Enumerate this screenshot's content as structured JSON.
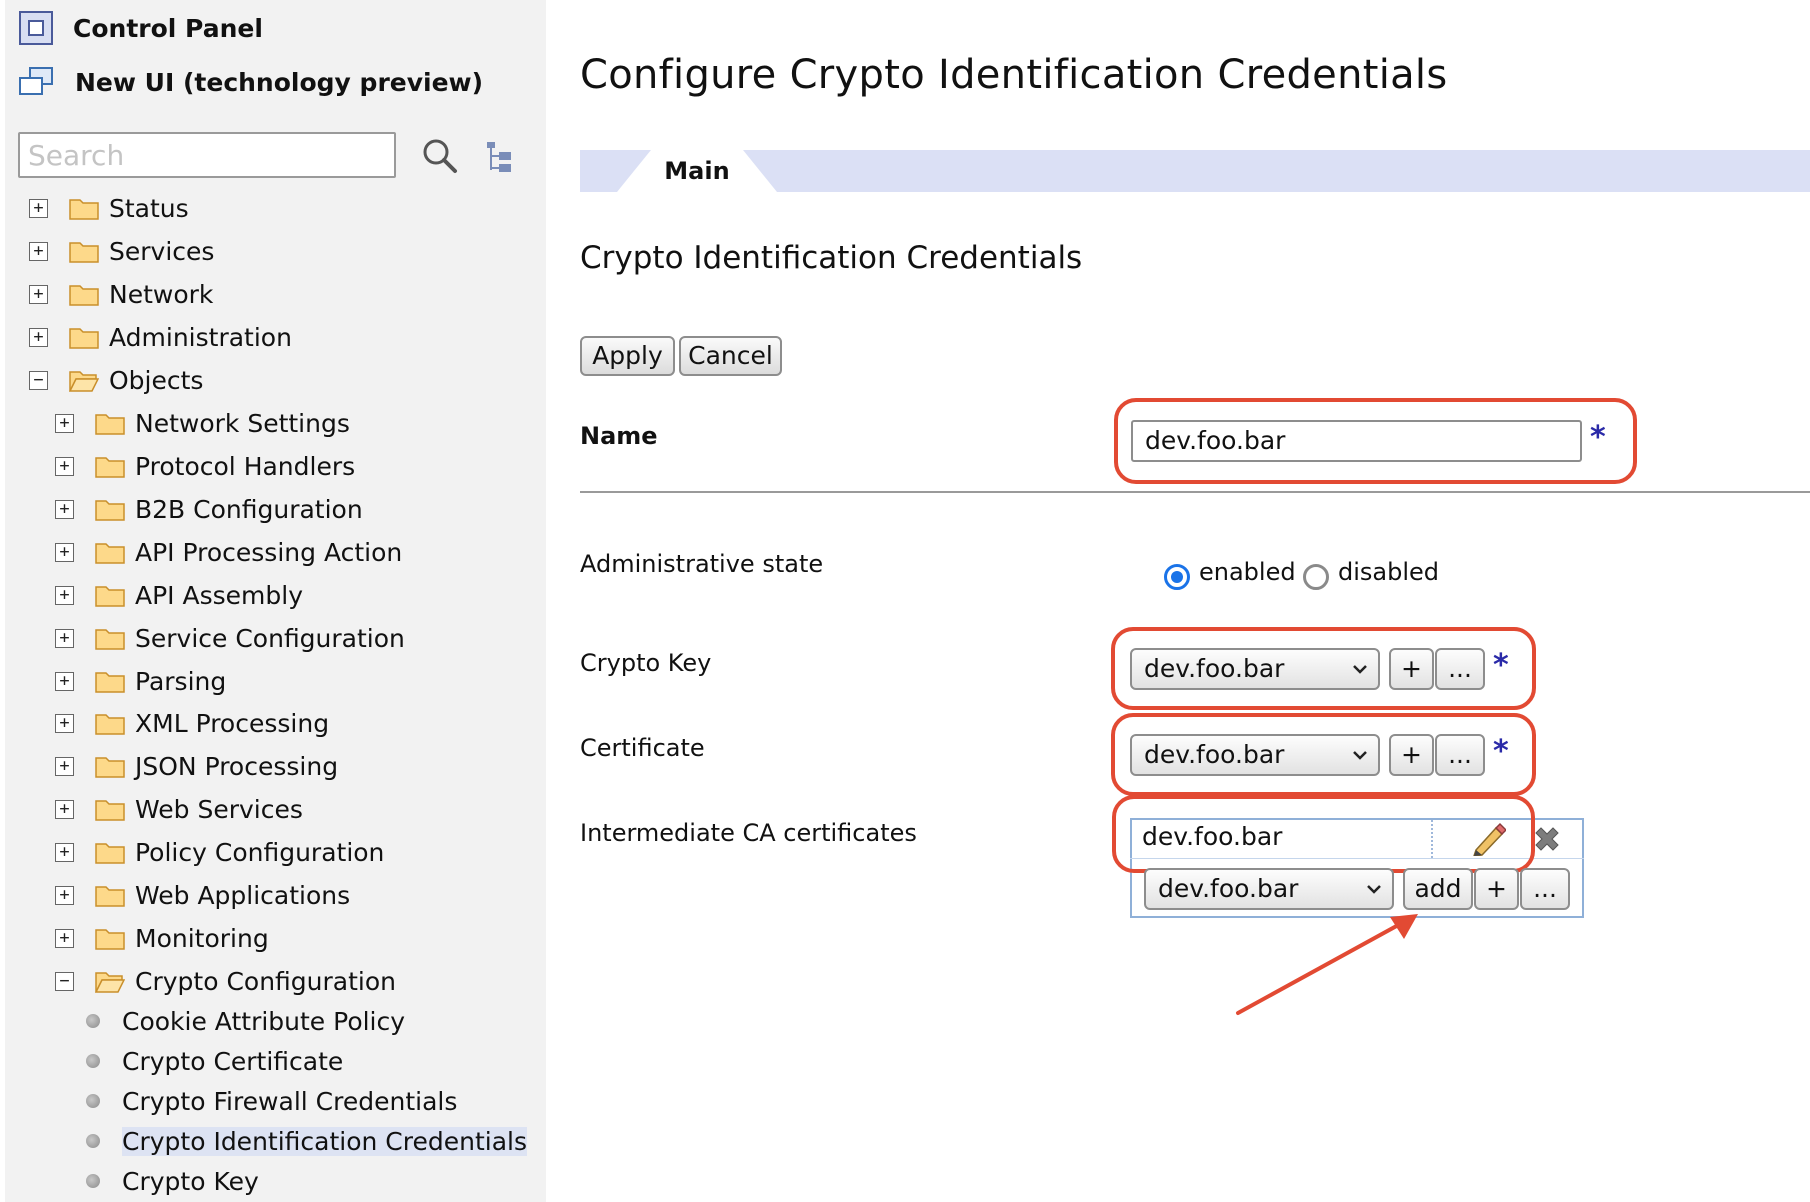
{
  "sidebar": {
    "control_panel": "Control Panel",
    "new_ui": "New UI (technology preview)",
    "search_placeholder": "Search",
    "tree": [
      {
        "label": "Status",
        "state": "+"
      },
      {
        "label": "Services",
        "state": "+"
      },
      {
        "label": "Network",
        "state": "+"
      },
      {
        "label": "Administration",
        "state": "+"
      },
      {
        "label": "Objects",
        "state": "−"
      }
    ],
    "objects_children": [
      {
        "label": "Network Settings",
        "state": "+"
      },
      {
        "label": "Protocol Handlers",
        "state": "+"
      },
      {
        "label": "B2B Configuration",
        "state": "+"
      },
      {
        "label": "API Processing Action",
        "state": "+"
      },
      {
        "label": "API Assembly",
        "state": "+"
      },
      {
        "label": "Service Configuration",
        "state": "+"
      },
      {
        "label": "Parsing",
        "state": "+"
      },
      {
        "label": "XML Processing",
        "state": "+"
      },
      {
        "label": "JSON Processing",
        "state": "+"
      },
      {
        "label": "Web Services",
        "state": "+"
      },
      {
        "label": "Policy Configuration",
        "state": "+"
      },
      {
        "label": "Web Applications",
        "state": "+"
      },
      {
        "label": "Monitoring",
        "state": "+"
      },
      {
        "label": "Crypto Configuration",
        "state": "−"
      }
    ],
    "crypto_children": [
      {
        "label": "Cookie Attribute Policy"
      },
      {
        "label": "Crypto Certificate"
      },
      {
        "label": "Crypto Firewall Credentials"
      },
      {
        "label": "Crypto Identification Credentials",
        "selected": true
      },
      {
        "label": "Crypto Key"
      }
    ]
  },
  "main": {
    "title": "Configure Crypto Identification Credentials",
    "tab": "Main",
    "section_title": "Crypto Identification Credentials",
    "apply_label": "Apply",
    "cancel_label": "Cancel",
    "required_mark": "*",
    "name": {
      "label": "Name",
      "value": "dev.foo.bar"
    },
    "admin_state": {
      "label": "Administrative state",
      "enabled": "enabled",
      "disabled": "disabled",
      "selected": "enabled"
    },
    "crypto_key": {
      "label": "Crypto Key",
      "value": "dev.foo.bar"
    },
    "certificate": {
      "label": "Certificate",
      "value": "dev.foo.bar"
    },
    "intermediate": {
      "label": "Intermediate CA certificates",
      "value": "dev.foo.bar",
      "select_value": "dev.foo.bar",
      "add_label": "add"
    },
    "plus_label": "+",
    "more_label": "..."
  },
  "colors": {
    "highlight": "#e24a33",
    "tab_strip": "#dbe0f5",
    "required": "#2a2aa8",
    "radio_on": "#1a73e8"
  }
}
